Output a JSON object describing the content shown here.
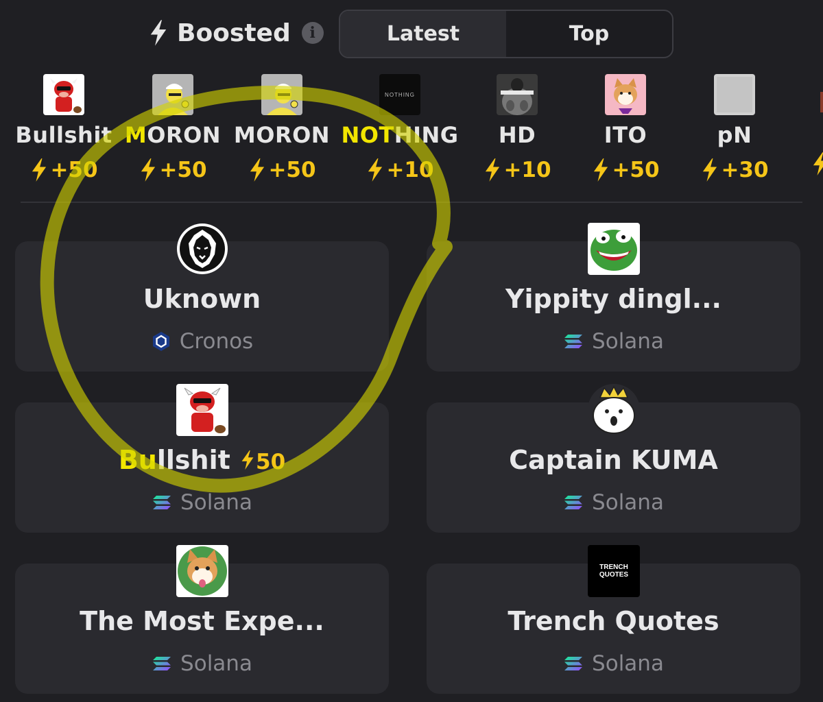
{
  "header": {
    "title": "Boosted",
    "tabs": [
      {
        "label": "Latest",
        "active": true
      },
      {
        "label": "Top",
        "active": false
      }
    ]
  },
  "boosted": [
    {
      "name": "Bullshit",
      "highlight": "",
      "rest": "Bullshit",
      "boost": "+50",
      "icon": "red-bull-avatar"
    },
    {
      "name": "MORON",
      "highlight": "M",
      "rest": "ORON",
      "boost": "+50",
      "icon": "cartoon-man-avatar"
    },
    {
      "name": "MORON",
      "highlight": "",
      "rest": "MORON",
      "boost": "+50",
      "icon": "cartoon-man-avatar"
    },
    {
      "name": "NOTHING",
      "highlight": "NOT",
      "rest": "HING",
      "boost": "+10",
      "icon": "nothing-logo"
    },
    {
      "name": "HD",
      "highlight": "",
      "rest": "HD",
      "boost": "+10",
      "icon": "hits-different-avatar"
    },
    {
      "name": "ITO",
      "highlight": "",
      "rest": "ITO",
      "boost": "+50",
      "icon": "shiba-avatar"
    },
    {
      "name": "pN",
      "highlight": "",
      "rest": "pN",
      "boost": "+30",
      "icon": "gray-avatar"
    }
  ],
  "tokens": [
    {
      "name": "Uknown",
      "highlight": "",
      "rest": "Uknown",
      "boost": "",
      "chain": "Cronos",
      "icon": "lion-avatar"
    },
    {
      "name": "Yippity dingl...",
      "highlight": "",
      "rest": "Yippity dingl...",
      "boost": "",
      "chain": "Solana",
      "icon": "pepe-avatar"
    },
    {
      "name": "Bullshit",
      "highlight": "Bu",
      "rest": "llshit",
      "boost": "50",
      "chain": "Solana",
      "icon": "red-bull-avatar"
    },
    {
      "name": "Captain KUMA",
      "highlight": "",
      "rest": "Captain KUMA",
      "boost": "",
      "chain": "Solana",
      "icon": "kuma-avatar"
    },
    {
      "name": "The Most Expe...",
      "highlight": "",
      "rest": "The Most Expe...",
      "boost": "",
      "chain": "Solana",
      "icon": "shiba-avatar"
    },
    {
      "name": "Trench Quotes",
      "highlight": "",
      "rest": "Trench Quotes",
      "boost": "",
      "chain": "Solana",
      "icon": "trench-quotes-logo",
      "logo_text": [
        "TRENCH",
        "QUOTES"
      ]
    }
  ],
  "colors": {
    "background": "#1f1f23",
    "card": "#2a2a2f",
    "boost": "#f5c518",
    "highlight": "#f2e600",
    "muted": "#8a8a90"
  }
}
